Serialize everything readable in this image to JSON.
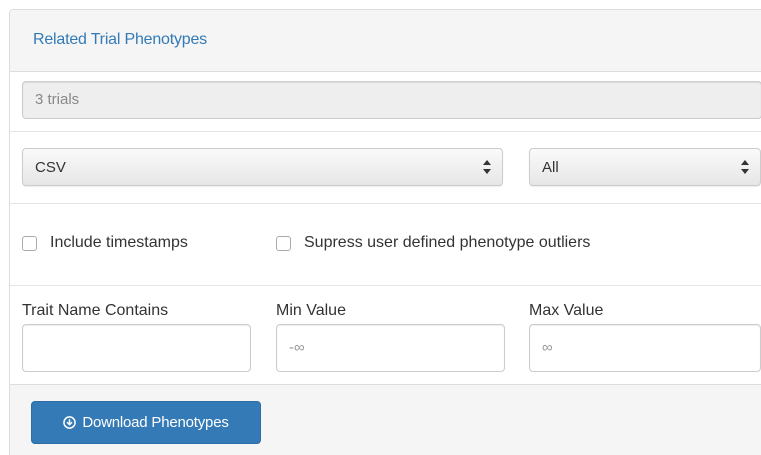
{
  "panel": {
    "title": "Related Trial Phenotypes"
  },
  "trials_field": {
    "value": "3 trials"
  },
  "format_select": {
    "selected": "CSV"
  },
  "scope_select": {
    "selected": "All"
  },
  "options": {
    "include_timestamps": "Include timestamps",
    "suppress_outliers": "Supress user defined phenotype outliers"
  },
  "filters": {
    "trait_label": "Trait Name Contains",
    "trait_value": "",
    "min_label": "Min Value",
    "min_placeholder": "-∞",
    "max_label": "Max Value",
    "max_placeholder": "∞"
  },
  "download_button": {
    "label": "Download Phenotypes",
    "icon": "download-circle-icon"
  },
  "colors": {
    "title": "#337ab7",
    "button": "#337ab7"
  }
}
